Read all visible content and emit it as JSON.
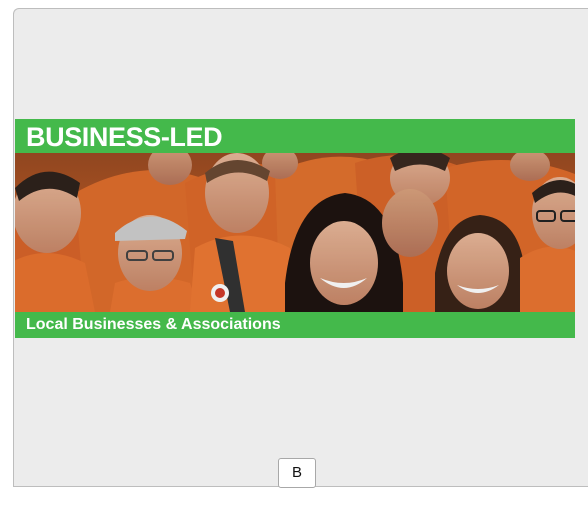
{
  "panel": {
    "heading": "BUSINESS-LED",
    "caption": "Local Businesses & Associations"
  },
  "controls": {
    "button_label": "B"
  },
  "colors": {
    "band_green": "#44b94b",
    "panel_background": "#ececec",
    "uniform_orange": "#e8702a"
  }
}
